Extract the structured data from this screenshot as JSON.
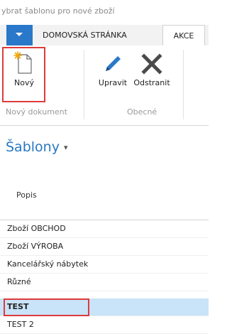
{
  "window": {
    "title": "ybrat šablonu pro nové zboží"
  },
  "ribbon": {
    "tabs": [
      "DOMOVSKÁ STRÁNKA",
      "AKCE"
    ],
    "buttons": {
      "new": "Nový",
      "edit": "Upravit",
      "delete": "Odstranit"
    },
    "groups": {
      "new_document": "Nový dokument",
      "general": "Obecné"
    }
  },
  "page": {
    "title": "Šablony",
    "caret": "▾"
  },
  "list": {
    "column_header": "Popis",
    "rows": [
      "Zboží OBCHOD",
      "Zboží VÝROBA",
      "Kancelářský nábytek",
      "Různé",
      "TEST",
      "TEST 2"
    ],
    "selected_index": 4
  },
  "colors": {
    "accent": "#2a78c9",
    "selection": "#c9e3f9",
    "highlight": "#dd3b3b",
    "title": "#2778c4"
  }
}
